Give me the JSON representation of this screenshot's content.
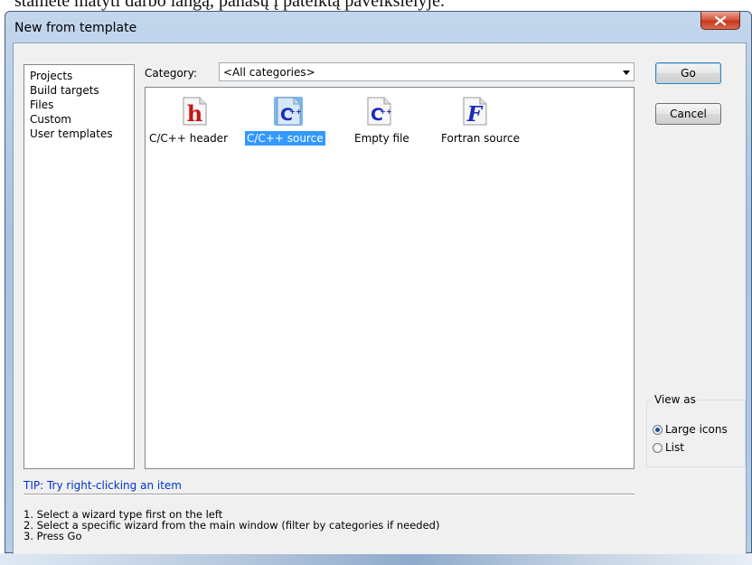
{
  "background": {
    "doc_text": "stamete matyti darbo langą, panašų į pateiktą paveikslėlyje."
  },
  "window": {
    "title": "New from template"
  },
  "wizard_types": [
    {
      "label": "Projects"
    },
    {
      "label": "Build targets"
    },
    {
      "label": "Files",
      "selected": true
    },
    {
      "label": "Custom"
    },
    {
      "label": "User templates"
    }
  ],
  "category": {
    "label": "Category:",
    "value": "<All categories>"
  },
  "templates": [
    {
      "label": "C/C++ header",
      "icon": "h-header-icon",
      "selected": false
    },
    {
      "label": "C/C++ source",
      "icon": "cpp-source-icon",
      "selected": true
    },
    {
      "label": "Empty file",
      "icon": "cpp-empty-icon",
      "selected": false
    },
    {
      "label": "Fortran source",
      "icon": "fortran-icon",
      "selected": false
    }
  ],
  "buttons": {
    "go": "Go",
    "cancel": "Cancel"
  },
  "view_as": {
    "legend": "View as",
    "options": [
      {
        "label": "Large icons",
        "checked": true
      },
      {
        "label": "List",
        "checked": false
      }
    ]
  },
  "tip": "TIP: Try right-clicking an item",
  "help_lines": [
    "1. Select a wizard type first on the left",
    "2. Select a specific wizard from the main window (filter by categories if needed)",
    "3. Press Go"
  ],
  "colors": {
    "selection": "#3399ff",
    "tip_text": "#0033cc",
    "title_bar": "#b5cbe6"
  }
}
